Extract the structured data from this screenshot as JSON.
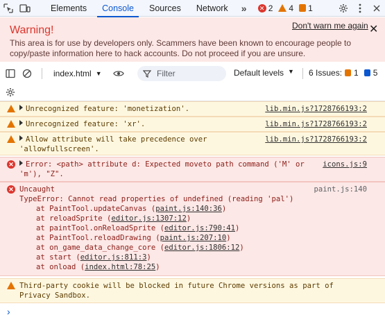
{
  "toolbar_tabs": {
    "tabs": [
      "Elements",
      "Console",
      "Sources",
      "Network"
    ],
    "more": "»",
    "errors": "2",
    "warnings": "4",
    "issues": "1"
  },
  "banner": {
    "title": "Warning!",
    "dont_warn": "Don't warn me again",
    "text": "This area is for use by developers only. Scammers have been known to encourage people to copy/paste information here to hack accounts. Do not proceed if you are unsure.",
    "close": "✕"
  },
  "console_toolbar": {
    "context": "index.html",
    "filter_placeholder": "Filter",
    "levels": "Default levels",
    "issues_label": "6 Issues:",
    "issues_warn": "1",
    "issues_info": "5"
  },
  "messages": [
    {
      "level": "warning",
      "text": "Unrecognized feature: 'monetization'.",
      "source": "lib.min.js?1728766193:2"
    },
    {
      "level": "warning",
      "text": "Unrecognized feature: 'xr'.",
      "source": "lib.min.js?1728766193:2"
    },
    {
      "level": "warning",
      "text": "Allow attribute will take precedence over",
      "text2": "'allowfullscreen'.",
      "source": "lib.min.js?1728766193:2"
    },
    {
      "level": "error",
      "text": "Error: <path> attribute d: Expected moveto path command ('M' or",
      "text2": "'m'), \"Z\".",
      "source": "icons.js:9"
    },
    {
      "level": "error",
      "text": "Uncaught",
      "source": "paint.js:140",
      "lines": [
        "TypeError: Cannot read properties of undefined (reading 'pal')",
        "at PaintTool.updateCanvas (",
        "at reloadSprite (",
        "at paintTool.onReloadSprite (",
        "at PaintTool.reloadDrawing (",
        "at on_game_data_change_core (",
        "at start (",
        "at onload ("
      ],
      "links": [
        "paint.js:140:36",
        "editor.js:1307:12",
        "editor.js:790:41",
        "paint.js:207:10",
        "editor.js:1806:12",
        "editor.js:811:3",
        "index.html:78:25"
      ]
    },
    {
      "level": "warning",
      "text": "Third-party cookie will be blocked in future Chrome versions as part of",
      "text2": "Privacy Sandbox."
    }
  ],
  "prompt": "›"
}
